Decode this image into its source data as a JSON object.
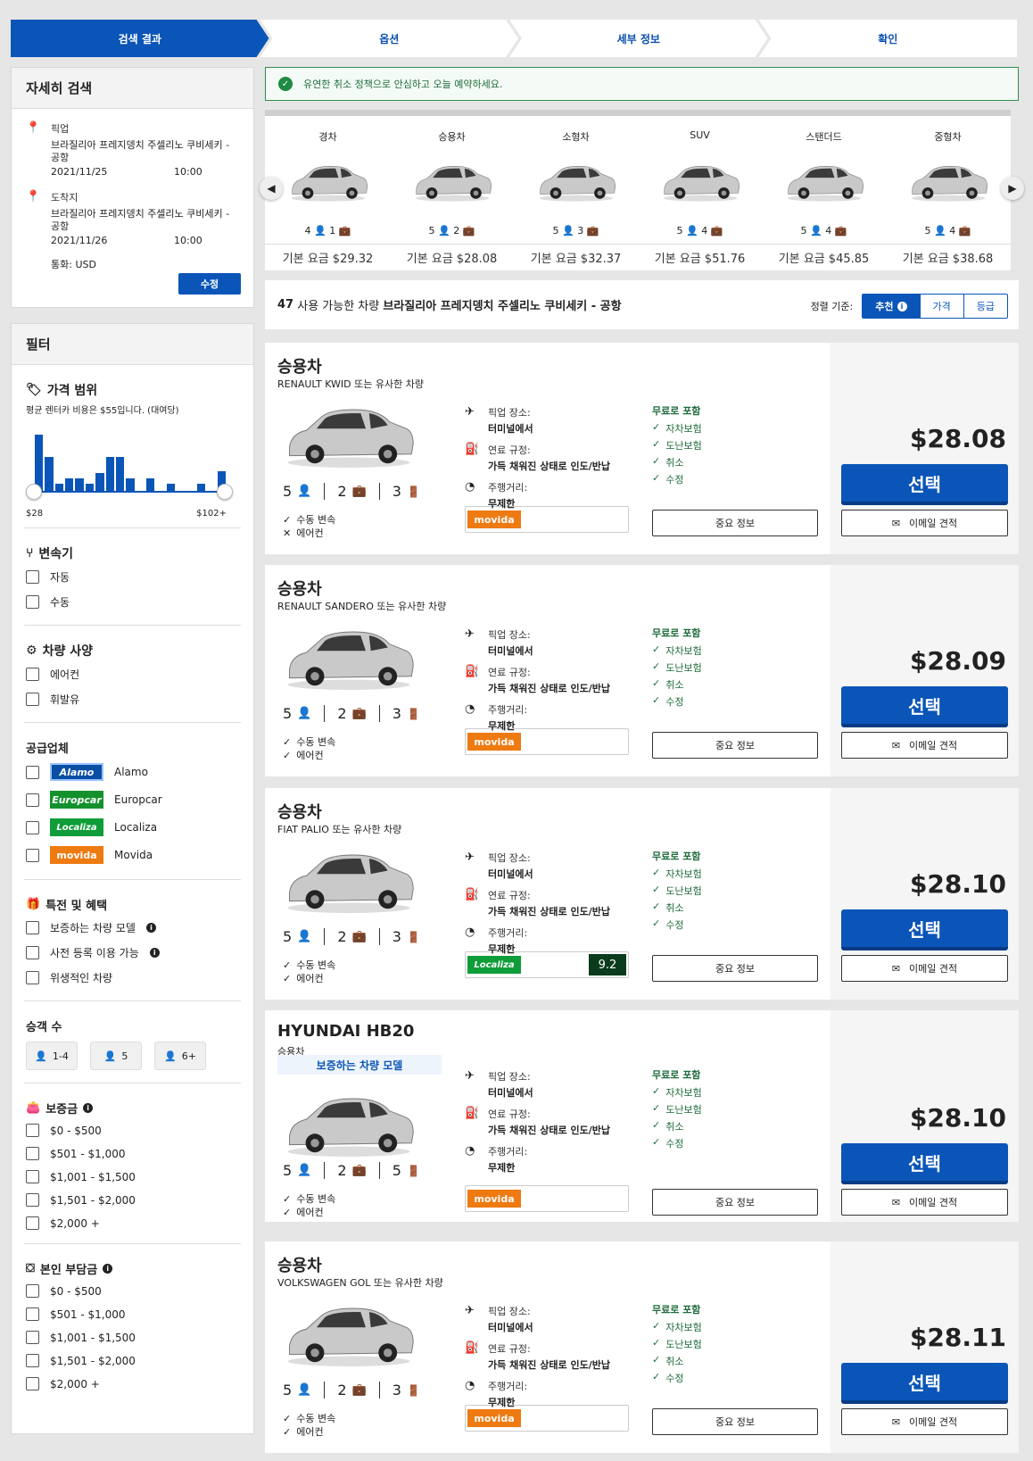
{
  "steps": [
    "검색 결과",
    "옵션",
    "세부 정보",
    "확인"
  ],
  "search": {
    "title": "자세히 검색",
    "pickup_label": "픽업",
    "pickup_location": "브라질리아 프레지뎅치 주셀리노 쿠비세키 - 공항",
    "pickup_date": "2021/11/25",
    "pickup_time": "10:00",
    "dropoff_label": "도착지",
    "dropoff_location": "브라질리아 프레지뎅치 주셀리노 쿠비세키 - 공항",
    "dropoff_date": "2021/11/26",
    "dropoff_time": "10:00",
    "currency": "통화: USD",
    "edit_label": "수정"
  },
  "filters": {
    "title": "필터",
    "price": {
      "title": "가격 범위",
      "note": "평균 렌터카 비용은 $55입니다. (대여당)",
      "min": "$28",
      "max": "$102+",
      "histogram": [
        0.9,
        0.55,
        0.12,
        0.2,
        0.2,
        0.12,
        0.28,
        0.55,
        0.55,
        0.2,
        0,
        0.2,
        0,
        0.12,
        0,
        0,
        0.12,
        0,
        0.32
      ]
    },
    "transmission": {
      "title": "변속기",
      "options": [
        "자동",
        "수동"
      ]
    },
    "specs": {
      "title": "차량 사양",
      "options": [
        "에어컨",
        "휘발유"
      ]
    },
    "vendors": {
      "title": "공급업체",
      "options": [
        {
          "name": "Alamo",
          "logo": "Alamo",
          "color": "#0b4fa5"
        },
        {
          "name": "Europcar",
          "logo": "Europcar",
          "color": "#13912d"
        },
        {
          "name": "Localiza",
          "logo": "Localiza",
          "color": "#0e9d38"
        },
        {
          "name": "Movida",
          "logo": "movida",
          "color": "#ee7a12"
        }
      ]
    },
    "deals": {
      "title": "특전 및 혜택",
      "options": [
        "보증하는 차량 모델",
        "사전 등록 이용 가능",
        "위생적인 차량"
      ]
    },
    "passengers": {
      "title": "승객 수",
      "options": [
        "1-4",
        "5",
        "6+"
      ]
    },
    "deposit": {
      "title": "보증금",
      "options": [
        "$0 - $500",
        "$501 - $1,000",
        "$1,001 - $1,500",
        "$1,501 - $2,000",
        "$2,000 +"
      ]
    },
    "excess": {
      "title": "본인 부담금",
      "options": [
        "$0 - $500",
        "$501 - $1,000",
        "$1,001 - $1,500",
        "$1,501 - $2,000",
        "$2,000 +"
      ]
    }
  },
  "banner": "유연한 취소 정책으로 안심하고 오늘 예약하세요.",
  "categories": [
    {
      "name": "경차",
      "caps": "4 👤 1 💼",
      "price": "기본 요금 $29.32"
    },
    {
      "name": "승용차",
      "caps": "5 👤 2 💼",
      "price": "기본 요금 $28.08"
    },
    {
      "name": "소형차",
      "caps": "5 👤 3 💼",
      "price": "기본 요금 $32.37"
    },
    {
      "name": "SUV",
      "caps": "5 👤 4 💼",
      "price": "기본 요금 $51.76"
    },
    {
      "name": "스탠더드",
      "caps": "5 👤 4 💼",
      "price": "기본 요금 $45.85"
    },
    {
      "name": "중형차",
      "caps": "5 👤 4 💼",
      "price": "기본 요금 $38.68"
    }
  ],
  "results": {
    "count": "47",
    "text": "사용 가능한 차량",
    "location": "브라질리아 프레지뎅치 주셀리노 쿠비세키 - 공항",
    "sort_label": "정렬 기준:",
    "sort_options": [
      "추천",
      "가격",
      "등급"
    ]
  },
  "labels": {
    "pickup_place": "픽업 장소:",
    "pickup_place_val": "터미널에서",
    "fuel": "연료 규정:",
    "fuel_val": "가득 채워진 상태로 인도/반납",
    "mileage": "주행거리:",
    "mileage_val": "무제한",
    "free_title": "무료로 포함",
    "free_items": [
      "자차보험",
      "도난보험",
      "취소",
      "수정"
    ],
    "manual": "수동 변속",
    "ac": "에어컨",
    "info_button": "중요 정보",
    "select_button": "선택",
    "email_button": "이메일 견적",
    "guaranteed": "보증하는 차량 모델"
  },
  "cars": [
    {
      "title": "승용차",
      "sub": "RENAULT KWID 또는 유사한 차량",
      "seats": "5",
      "bags": "2",
      "doors": "3",
      "ac_icon": "✕",
      "vendor": "movida",
      "price": "$28.08"
    },
    {
      "title": "승용차",
      "sub": "RENAULT SANDERO 또는 유사한 차량",
      "seats": "5",
      "bags": "2",
      "doors": "3",
      "ac_icon": "✓",
      "vendor": "movida",
      "price": "$28.09"
    },
    {
      "title": "승용차",
      "sub": "FIAT PALIO 또는 유사한 차량",
      "seats": "5",
      "bags": "2",
      "doors": "3",
      "ac_icon": "✓",
      "vendor": "Localiza",
      "score": "9.2",
      "price": "$28.10"
    },
    {
      "title": "HYUNDAI HB20",
      "sub": "승용차",
      "seats": "5",
      "bags": "2",
      "doors": "5",
      "ac_icon": "✓",
      "vendor": "movida",
      "price": "$28.10",
      "guaranteed": true
    },
    {
      "title": "승용차",
      "sub": "VOLKSWAGEN GOL 또는 유사한 차량",
      "seats": "5",
      "bags": "2",
      "doors": "3",
      "ac_icon": "✓",
      "vendor": "movida",
      "price": "$28.11"
    }
  ]
}
